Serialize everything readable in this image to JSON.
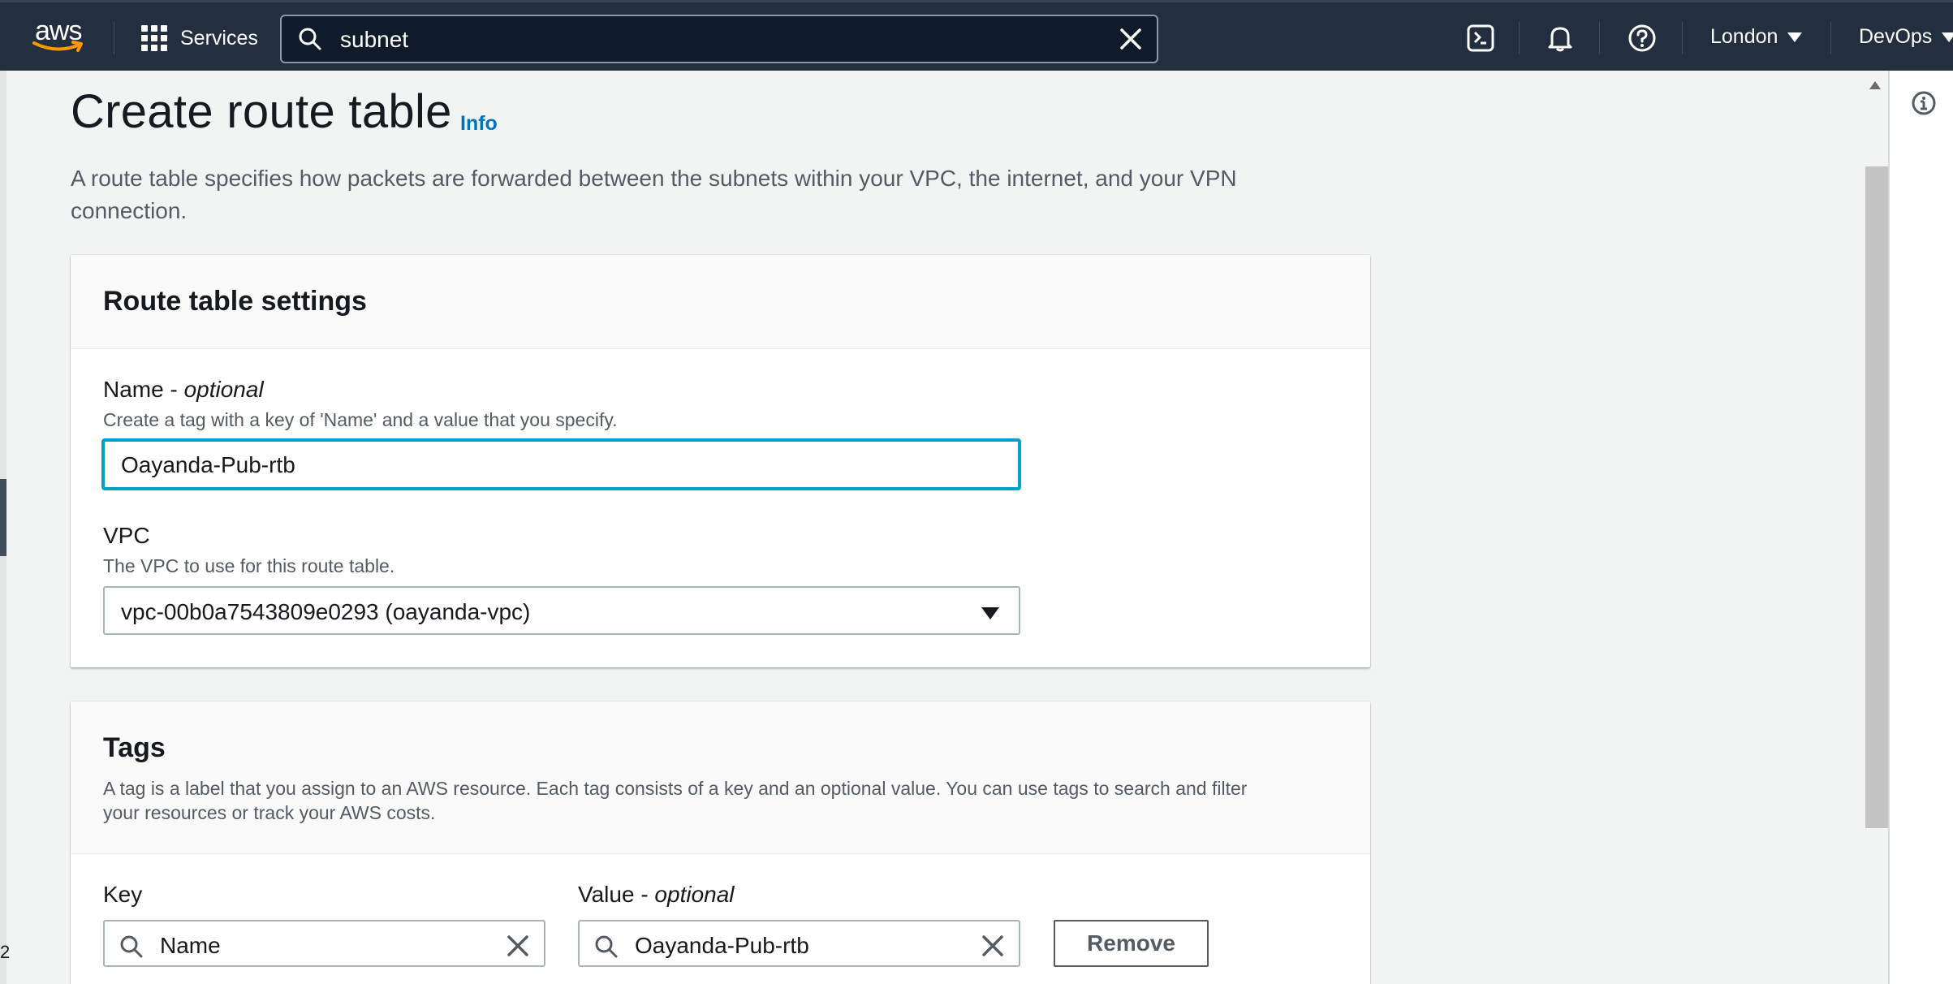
{
  "nav": {
    "logo_text": "aws",
    "services_label": "Services",
    "search_value": "subnet",
    "region": "London",
    "account": "DevOps",
    "icons": [
      "cloudshell-icon",
      "bell-icon",
      "help-icon"
    ],
    "background": "#232f3e"
  },
  "page": {
    "title": "Create route table",
    "info_link": "Info",
    "description": "A route table specifies how packets are forwarded between the subnets within your VPC, the internet, and your VPN connection."
  },
  "settings": {
    "title": "Route table settings",
    "name_label": "Name - ",
    "name_optional": "optional",
    "name_desc": "Create a tag with a key of 'Name' and a value that you specify.",
    "name_value": "Oayanda-Pub-rtb",
    "vpc_label": "VPC",
    "vpc_desc": "The VPC to use for this route table.",
    "vpc_value": "vpc-00b0a7543809e0293 (oayanda-vpc)"
  },
  "tags": {
    "title": "Tags",
    "desc_line1": "A tag is a label that you assign to an AWS resource. Each tag consists of a key and an optional value. You can use tags to search and filter",
    "desc_line2": "your resources or track your AWS costs.",
    "key_label": "Key",
    "value_label": "Value - ",
    "value_optional": "optional",
    "rows": [
      {
        "key": "Name",
        "value": "Oayanda-Pub-rtb",
        "remove_label": "Remove"
      }
    ]
  },
  "colors": {
    "accent_link": "#0073bb",
    "focus_ring": "#00a1c9",
    "page_bg": "#f2f3f3"
  }
}
